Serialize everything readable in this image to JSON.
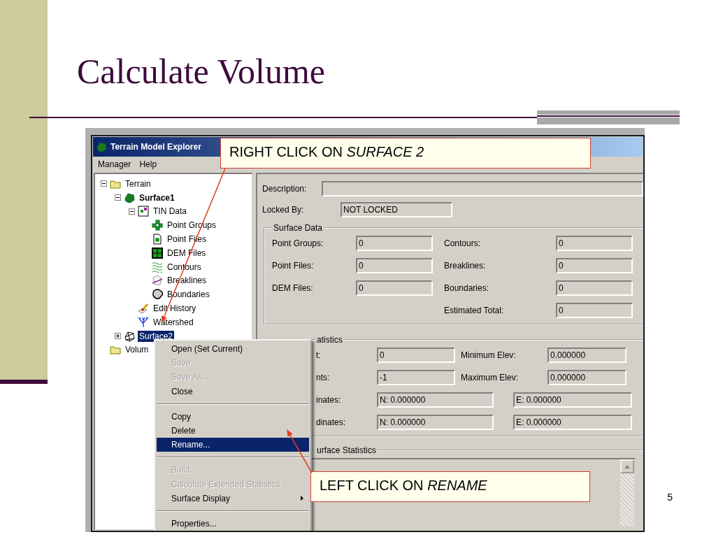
{
  "slide": {
    "title": "Calculate Volume",
    "page_number": "5"
  },
  "window": {
    "title": "Terrain Model Explorer",
    "menu": [
      "Manager",
      "Help"
    ]
  },
  "tree": [
    {
      "label": "Terrain",
      "kind": "folder",
      "expanded": true,
      "selected": false,
      "current": false,
      "children": [
        {
          "label": "Surface1",
          "kind": "surface",
          "expanded": true,
          "selected": false,
          "current": true,
          "children": [
            {
              "label": "TIN Data",
              "kind": "tin",
              "expanded": true,
              "selected": false,
              "current": false,
              "children": [
                {
                  "label": "Point Groups",
                  "kind": "groups",
                  "selected": false,
                  "current": false
                },
                {
                  "label": "Point Files",
                  "kind": "file",
                  "selected": false,
                  "current": false
                },
                {
                  "label": "DEM Files",
                  "kind": "grid",
                  "selected": false,
                  "current": false
                },
                {
                  "label": "Contours",
                  "kind": "contours",
                  "selected": false,
                  "current": false
                },
                {
                  "label": "Breaklines",
                  "kind": "breaklines",
                  "selected": false,
                  "current": false
                },
                {
                  "label": "Boundaries",
                  "kind": "boundary",
                  "selected": false,
                  "current": false
                }
              ]
            },
            {
              "label": "Edit History",
              "kind": "history",
              "selected": false,
              "current": false
            },
            {
              "label": "Watershed",
              "kind": "watershed",
              "selected": false,
              "current": false
            }
          ]
        },
        {
          "label": "Surface2",
          "kind": "mesh",
          "expanded": false,
          "selected": true,
          "current": false
        }
      ]
    },
    {
      "label": "Volum",
      "kind": "folder",
      "selected": false,
      "current": false
    }
  ],
  "properties": {
    "description": {
      "label": "Description:"
    },
    "locked_by": {
      "label": "Locked By:",
      "value": "NOT LOCKED"
    }
  },
  "surface_data": {
    "title": "Surface Data",
    "left": [
      {
        "label": "Point Groups:",
        "value": "0"
      },
      {
        "label": "Point Files:",
        "value": "0"
      },
      {
        "label": "DEM Files:",
        "value": "0"
      }
    ],
    "right": [
      {
        "label": "Contours:",
        "value": "0"
      },
      {
        "label": "Breaklines:",
        "value": "0"
      },
      {
        "label": "Boundaries:",
        "value": "0"
      },
      {
        "label": "Estimated Total:",
        "value": "0"
      }
    ]
  },
  "statistics": {
    "title": "atistics",
    "rows": [
      {
        "kind": "pair",
        "label": "t:",
        "value": "0",
        "label_2": "Minimum Elev:",
        "value_2": "0.000000"
      },
      {
        "kind": "pair",
        "label": "nts:",
        "value": "-1",
        "label_2": "Maximum Elev:",
        "value_2": "0.000000"
      },
      {
        "kind": "coords",
        "label": "inates:",
        "value": "N: 0.000000",
        "value_2": "E: 0.000000"
      },
      {
        "kind": "coords",
        "label": "dinates:",
        "value": "N: 0.000000",
        "value_2": "E: 0.000000"
      }
    ]
  },
  "surface_statistics": {
    "title": "urface Statistics"
  },
  "context_menu": [
    {
      "kind": "item",
      "label": "Open (Set Current)",
      "disabled": false,
      "selected": false
    },
    {
      "kind": "item",
      "label": "Save",
      "disabled": true,
      "selected": false
    },
    {
      "kind": "item",
      "label": "Save As...",
      "disabled": true,
      "selected": false
    },
    {
      "kind": "item",
      "label": "Close",
      "disabled": false,
      "selected": false
    },
    {
      "kind": "separator"
    },
    {
      "kind": "item",
      "label": "Copy",
      "disabled": false,
      "selected": false
    },
    {
      "kind": "item",
      "label": "Delete",
      "disabled": false,
      "selected": false
    },
    {
      "kind": "item",
      "label": "Rename...",
      "disabled": false,
      "selected": true
    },
    {
      "kind": "separator"
    },
    {
      "kind": "item",
      "label": "Build...",
      "disabled": true,
      "selected": false
    },
    {
      "kind": "item",
      "label": "Calculate Extended Statistics",
      "disabled": true,
      "selected": false
    },
    {
      "kind": "submenu",
      "label": "Surface Display",
      "disabled": false,
      "selected": false
    },
    {
      "kind": "separator"
    },
    {
      "kind": "item",
      "label": "Properties...",
      "disabled": false,
      "selected": false
    }
  ],
  "callouts": [
    {
      "text": "RIGHT CLICK ON *SURFACE 2*"
    },
    {
      "text": "LEFT CLICK ON *RENAME*"
    }
  ]
}
